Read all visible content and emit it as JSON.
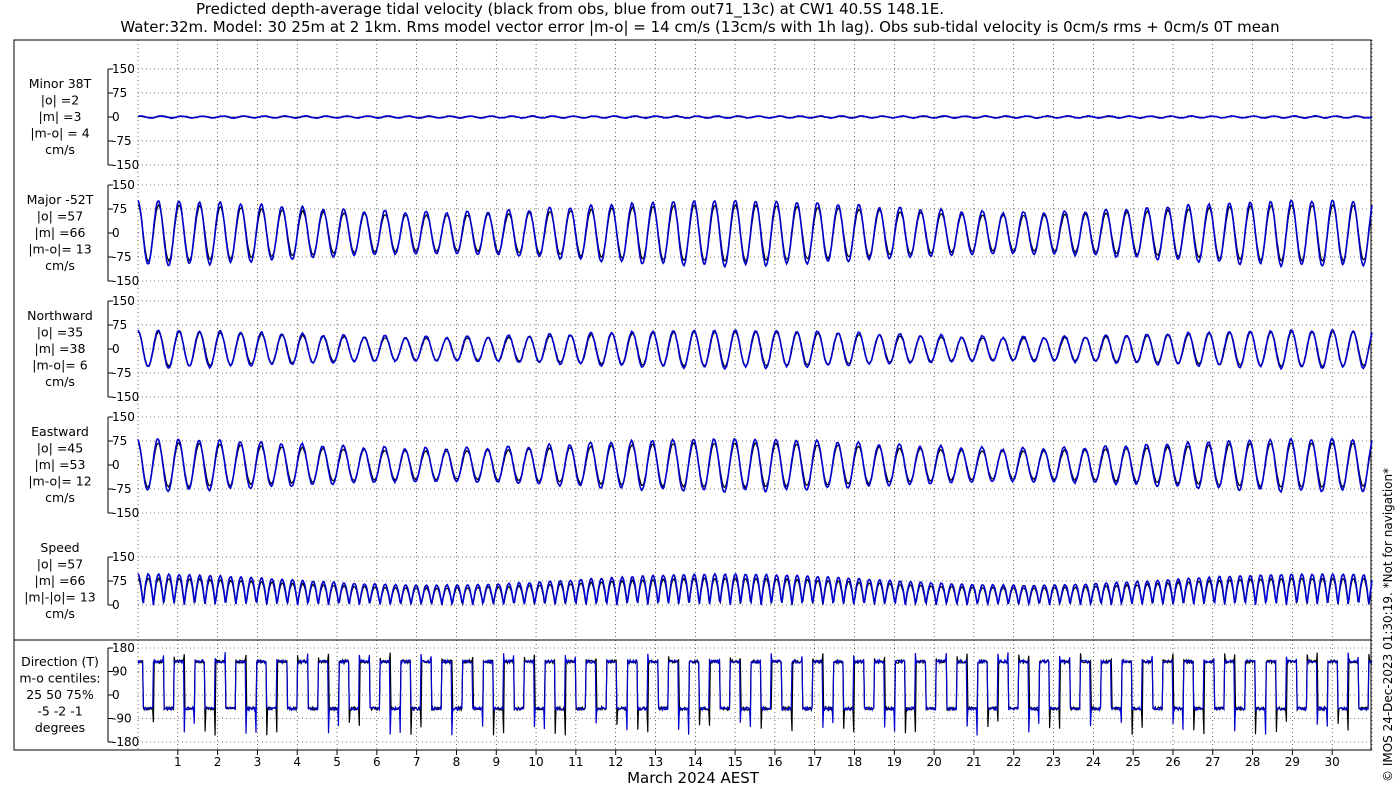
{
  "title_line1": "Predicted depth-average tidal velocity (black from obs, blue from out71_13c) at CW1 40.5S 148.1E.",
  "title_line2": "Water:32m. Model: 30 25m at 2 1km. Rms model vector error |m-o| = 14 cm/s (13cm/s with 1h lag). Obs sub-tidal velocity is 0cm/s rms + 0cm/s 0T mean",
  "copyright": "© IMOS 24-Dec-2023 01:30:19. *Not for navigation*",
  "colors": {
    "obs": "#000000",
    "model": "#0000cc",
    "axis": "#000000",
    "grid": "#000000"
  },
  "chart_data": [
    {
      "type": "line",
      "id": "minor",
      "label_lines": [
        "Minor 38T",
        "|o| =2",
        "|m| =3",
        "|m-o| = 4",
        "cm/s"
      ],
      "ylim": [
        -150,
        150
      ],
      "yticks": [
        150,
        75,
        0,
        -75,
        -150
      ],
      "amplitude_cm_s": {
        "obs": 2,
        "model": 3
      },
      "series": [
        {
          "name": "obs"
        },
        {
          "name": "out71_13c"
        }
      ]
    },
    {
      "type": "line",
      "id": "major",
      "label_lines": [
        "Major -52T",
        "|o| =57",
        "|m| =66",
        "|m-o|= 13",
        "cm/s"
      ],
      "ylim": [
        -150,
        150
      ],
      "yticks": [
        150,
        75,
        0,
        -75,
        -150
      ],
      "amplitude_cm_s": {
        "obs": 57,
        "model": 66
      },
      "series": [
        {
          "name": "obs"
        },
        {
          "name": "out71_13c"
        }
      ]
    },
    {
      "type": "line",
      "id": "north",
      "label_lines": [
        "Northward",
        "|o| =35",
        "|m| =38",
        "|m-o|= 6",
        "cm/s"
      ],
      "ylim": [
        -150,
        150
      ],
      "yticks": [
        150,
        75,
        0,
        -75,
        -150
      ],
      "amplitude_cm_s": {
        "obs": 35,
        "model": 38
      },
      "series": [
        {
          "name": "obs"
        },
        {
          "name": "out71_13c"
        }
      ]
    },
    {
      "type": "line",
      "id": "east",
      "label_lines": [
        "Eastward",
        "|o| =45",
        "|m| =53",
        "|m-o|= 12",
        "cm/s"
      ],
      "ylim": [
        -150,
        150
      ],
      "yticks": [
        150,
        75,
        0,
        -75,
        -150
      ],
      "amplitude_cm_s": {
        "obs": 45,
        "model": 53
      },
      "series": [
        {
          "name": "obs"
        },
        {
          "name": "out71_13c"
        }
      ]
    },
    {
      "type": "line",
      "id": "speed",
      "label_lines": [
        "Speed",
        "|o| =57",
        "|m| =66",
        "|m|-|o|= 13",
        "cm/s"
      ],
      "ylim": [
        0,
        150
      ],
      "yticks": [
        150,
        75,
        0
      ],
      "amplitude_cm_s": {
        "obs": 57,
        "model": 66
      },
      "series": [
        {
          "name": "obs"
        },
        {
          "name": "out71_13c"
        }
      ]
    },
    {
      "type": "line",
      "id": "direction",
      "label_lines": [
        "Direction (T)",
        "m-o centiles:",
        "25  50  75%",
        "-5 -2 -1",
        "degrees"
      ],
      "ylim": [
        -180,
        180
      ],
      "yticks": [
        180,
        90,
        0,
        -90,
        -180
      ],
      "flood_deg": 128,
      "ebb_deg": -52,
      "series": [
        {
          "name": "obs"
        },
        {
          "name": "out71_13c"
        }
      ]
    }
  ],
  "x_axis": {
    "label": "March 2024 AEST",
    "range_days": [
      0,
      31
    ],
    "tick_labels": [
      "1",
      "2",
      "3",
      "4",
      "5",
      "6",
      "7",
      "8",
      "9",
      "10",
      "11",
      "12",
      "13",
      "14",
      "15",
      "16",
      "17",
      "18",
      "19",
      "20",
      "21",
      "22",
      "23",
      "24",
      "25",
      "26",
      "27",
      "28",
      "29",
      "30"
    ],
    "grid": "dotted-hourly-daily"
  }
}
